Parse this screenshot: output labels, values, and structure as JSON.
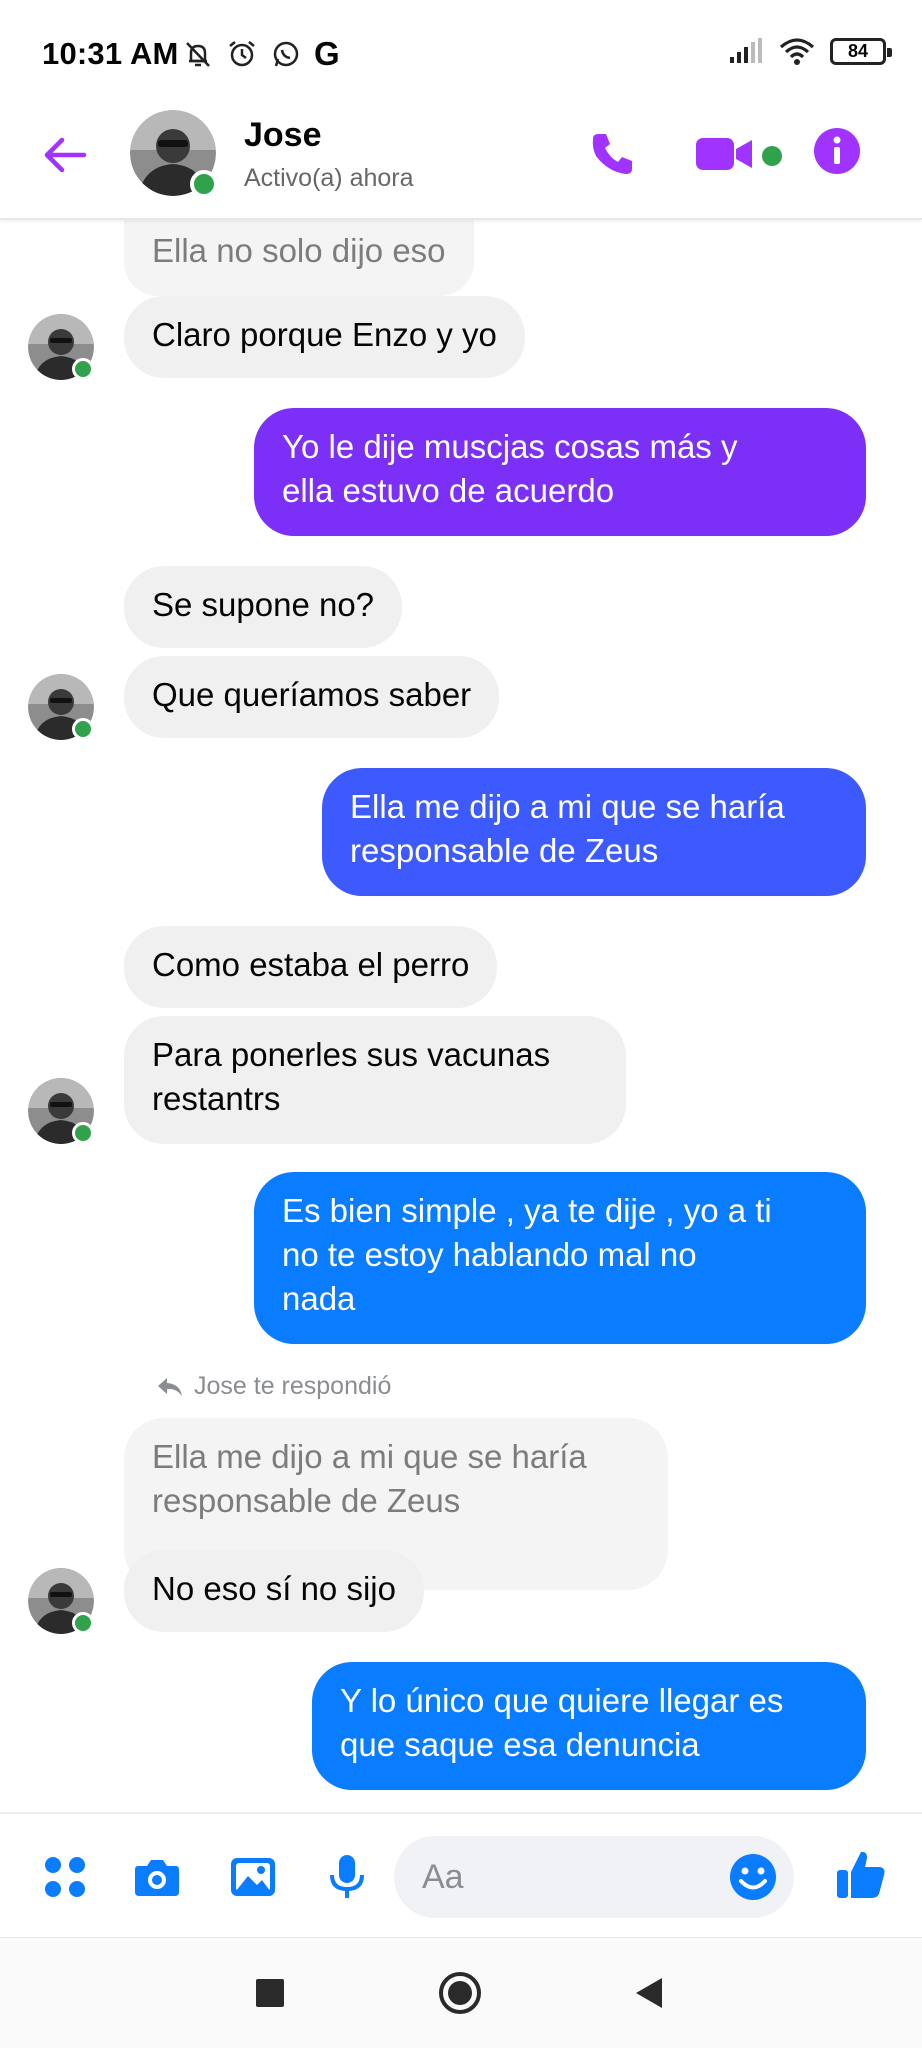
{
  "status_bar": {
    "time": "10:31 AM",
    "g_icon_text": "G",
    "battery": "84"
  },
  "header": {
    "contact_name": "Jose",
    "contact_status": "Activo(a) ahora"
  },
  "messages": [
    {
      "from": "them",
      "text": "Ella no solo dijo eso",
      "faded": true
    },
    {
      "from": "them",
      "text": "Claro porque Enzo y yo"
    },
    {
      "from": "me",
      "lines": [
        "Yo le dije muscjas cosas más y",
        "ella estuvo de acuerdo"
      ]
    },
    {
      "from": "them",
      "text": "Se supone no?"
    },
    {
      "from": "them",
      "text": "Que queríamos saber"
    },
    {
      "from": "me",
      "lines": [
        "Ella me dijo a mi que se haría",
        "responsable de Zeus"
      ]
    },
    {
      "from": "them",
      "text": "Como estaba el perro"
    },
    {
      "from": "them",
      "lines": [
        "Para ponerles sus vacunas",
        "restantrs"
      ]
    },
    {
      "from": "me",
      "lines": [
        "Es bien simple , ya te dije , yo a ti",
        "no te estoy hablando mal no",
        "nada"
      ]
    },
    {
      "from": "them",
      "reply_quote": true,
      "lines": [
        "Ella me dijo a mi que se haría",
        "responsable de Zeus"
      ]
    },
    {
      "from": "them",
      "text": "No eso sí no sijo"
    },
    {
      "from": "me",
      "lines": [
        "Y lo único que quiere llegar es",
        "que saque esa denuncia"
      ]
    }
  ],
  "reply_note": "Jose te respondió",
  "composer": {
    "placeholder": "Aa"
  },
  "colors": {
    "accent_purple": "#a033ff",
    "bubble_purple": "#7b2ff7",
    "bubble_indigo": "#3d5afe",
    "bubble_blue": "#0a7cff",
    "icon_blue": "#0a7cff",
    "online_green": "#31a24c",
    "incoming_bg": "#f0f0f0"
  },
  "icons": {
    "header": [
      "back-arrow-icon",
      "phone-icon",
      "video-camera-icon",
      "info-icon"
    ],
    "composer": [
      "apps-grid-icon",
      "camera-icon",
      "image-icon",
      "microphone-icon",
      "emoji-icon",
      "thumbs-up-icon"
    ],
    "navigation": [
      "recents-square-icon",
      "home-circle-icon",
      "back-triangle-icon"
    ]
  }
}
